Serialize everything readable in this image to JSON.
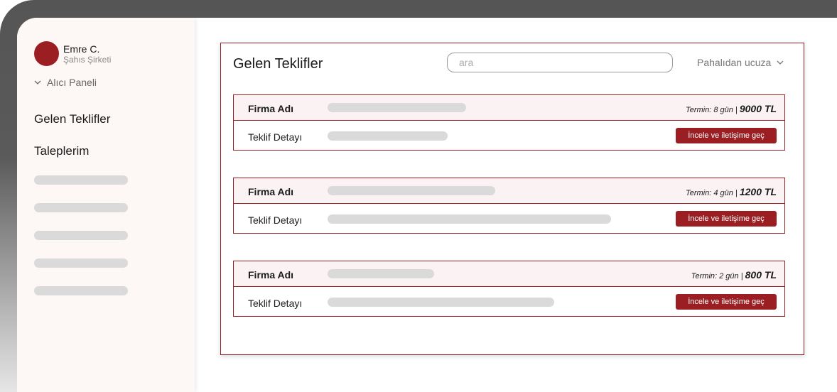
{
  "user": {
    "name": "Emre C.",
    "subtitle": "Şahıs Şirketi"
  },
  "sidebar": {
    "panel_label": "Alıcı Paneli",
    "items": [
      {
        "label": "Gelen Teklifler"
      },
      {
        "label": "Taleplerim"
      }
    ]
  },
  "main": {
    "title": "Gelen Teklifler",
    "search_placeholder": "ara",
    "sort_label": "Pahalıdan ucuza",
    "offers": [
      {
        "firm_label": "Firma Adı",
        "detail_label": "Teklif Detayı",
        "termin": "Termin: 8 gün",
        "price": "9000 TL",
        "button": "İncele ve iletişime geç"
      },
      {
        "firm_label": "Firma Adı",
        "detail_label": "Teklif Detayı",
        "termin": "Termin: 4 gün",
        "price": "1200 TL",
        "button": "İncele ve iletişime geç"
      },
      {
        "firm_label": "Firma Adı",
        "detail_label": "Teklif Detayı",
        "termin": "Termin: 2 gün",
        "price": "800 TL",
        "button": "İncele ve iletişime geç"
      }
    ]
  },
  "colors": {
    "accent": "#9b1f22",
    "sidebar_bg": "#fdf7f6",
    "header_bg": "#fbf3f3",
    "placeholder_bar": "#dadada"
  },
  "icons": {
    "panel_toggle": "chevron-down-icon",
    "sort": "chevron-down-icon"
  }
}
